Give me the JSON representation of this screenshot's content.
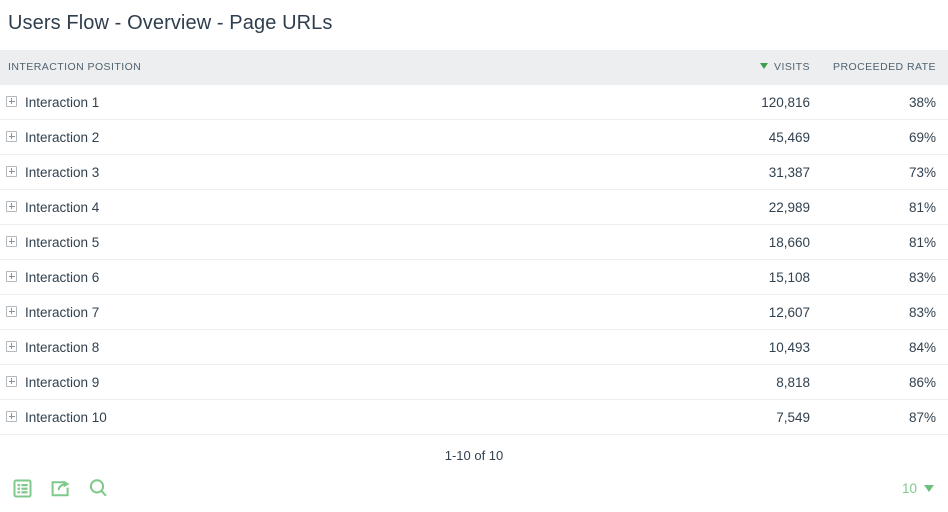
{
  "page_title": "Users Flow - Overview - Page URLs",
  "table": {
    "columns": [
      {
        "label": "INTERACTION POSITION",
        "align": "left",
        "sorted": false
      },
      {
        "label": "VISITS",
        "align": "right",
        "sorted": true,
        "sort_direction": "desc"
      },
      {
        "label": "PROCEEDED RATE",
        "align": "right",
        "sorted": false
      }
    ],
    "rows": [
      {
        "position": "Interaction 1",
        "visits": "120,816",
        "proceeded_rate": "38%"
      },
      {
        "position": "Interaction 2",
        "visits": "45,469",
        "proceeded_rate": "69%"
      },
      {
        "position": "Interaction 3",
        "visits": "31,387",
        "proceeded_rate": "73%"
      },
      {
        "position": "Interaction 4",
        "visits": "22,989",
        "proceeded_rate": "81%"
      },
      {
        "position": "Interaction 5",
        "visits": "18,660",
        "proceeded_rate": "81%"
      },
      {
        "position": "Interaction 6",
        "visits": "15,108",
        "proceeded_rate": "83%"
      },
      {
        "position": "Interaction 7",
        "visits": "12,607",
        "proceeded_rate": "83%"
      },
      {
        "position": "Interaction 8",
        "visits": "10,493",
        "proceeded_rate": "84%"
      },
      {
        "position": "Interaction 9",
        "visits": "8,818",
        "proceeded_rate": "86%"
      },
      {
        "position": "Interaction 10",
        "visits": "7,549",
        "proceeded_rate": "87%"
      }
    ]
  },
  "pagination": {
    "summary": "1-10 of 10",
    "page_size": "10"
  },
  "footer_tools": [
    {
      "name": "table-view-icon",
      "icon": "table-icon"
    },
    {
      "name": "export-icon",
      "icon": "export-icon"
    },
    {
      "name": "search-icon",
      "icon": "search-icon"
    }
  ],
  "colors": {
    "accent_green": "#7fc98a",
    "sort_green": "#3f9c4a",
    "header_bg": "#eceeef",
    "text_primary": "#31414f",
    "row_border": "#edeeef"
  }
}
